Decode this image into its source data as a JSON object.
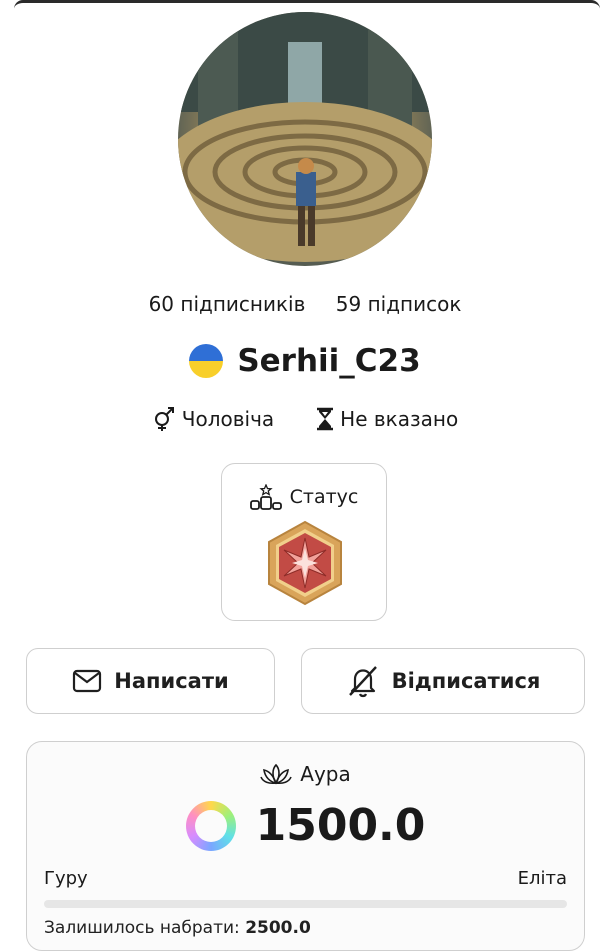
{
  "profile": {
    "followers": "60 підписників",
    "following": "59 підписок",
    "username": "Serhii_C23",
    "country_flag_icon": "ukraine-flag-icon",
    "gender_icon": "gender-icon",
    "gender": "Чоловіча",
    "age_icon": "hourglass-icon",
    "age": "Не вказано"
  },
  "status": {
    "label": "Статус",
    "icon": "podium-icon",
    "badge_icon": "star-hexagon-badge-icon"
  },
  "actions": {
    "write_label": "Написати",
    "write_icon": "mail-icon",
    "unsubscribe_label": "Відписатися",
    "unsubscribe_icon": "bell-off-icon"
  },
  "aura": {
    "title": "Аура",
    "icon": "lotus-icon",
    "value": "1500.0",
    "level_from": "Гуру",
    "level_to": "Еліта",
    "progress": 0.0,
    "remaining_label": "Залишилось набрати:",
    "remaining_value": "2500.0"
  },
  "colors": {
    "flag_blue": "#2f6fd6",
    "flag_yellow": "#f8cf2a",
    "badge_red": "#c24b45",
    "badge_gold": "#d9a45a"
  }
}
